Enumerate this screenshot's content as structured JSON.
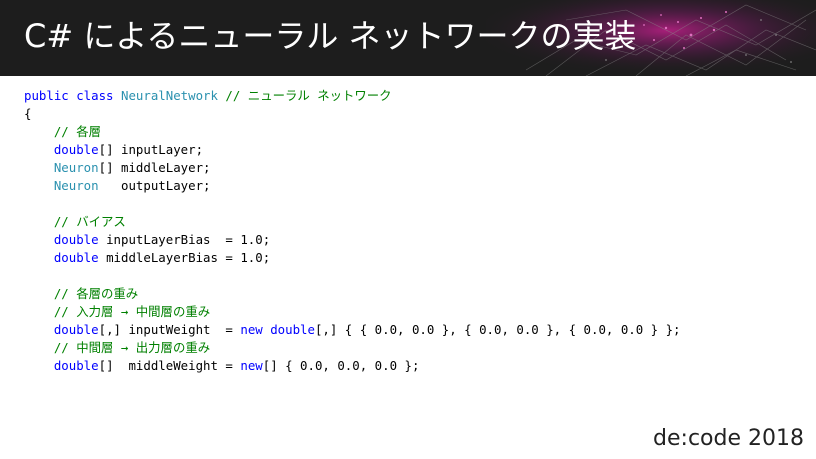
{
  "header": {
    "title": "C# によるニューラル ネットワークの実装"
  },
  "code_lines": [
    [
      {
        "t": "public ",
        "k": "k"
      },
      {
        "t": "class ",
        "k": "k"
      },
      {
        "t": "NeuralNetwork ",
        "k": "t"
      },
      {
        "t": "// ニューラル ネットワーク",
        "k": "c"
      }
    ],
    [
      {
        "t": "{",
        "k": "p"
      }
    ],
    [
      {
        "t": "    // 各層",
        "k": "c"
      }
    ],
    [
      {
        "t": "    ",
        "k": "p"
      },
      {
        "t": "double",
        "k": "k"
      },
      {
        "t": "[] inputLayer;",
        "k": "p"
      }
    ],
    [
      {
        "t": "    ",
        "k": "p"
      },
      {
        "t": "Neuron",
        "k": "t"
      },
      {
        "t": "[] middleLayer;",
        "k": "p"
      }
    ],
    [
      {
        "t": "    ",
        "k": "p"
      },
      {
        "t": "Neuron",
        "k": "t"
      },
      {
        "t": "   outputLayer;",
        "k": "p"
      }
    ],
    [],
    [
      {
        "t": "    // バイアス",
        "k": "c"
      }
    ],
    [
      {
        "t": "    ",
        "k": "p"
      },
      {
        "t": "double",
        "k": "k"
      },
      {
        "t": " inputLayerBias  = 1.0;",
        "k": "p"
      }
    ],
    [
      {
        "t": "    ",
        "k": "p"
      },
      {
        "t": "double",
        "k": "k"
      },
      {
        "t": " middleLayerBias = 1.0;",
        "k": "p"
      }
    ],
    [],
    [
      {
        "t": "    // 各層の重み",
        "k": "c"
      }
    ],
    [
      {
        "t": "    // 入力層 → 中間層の重み",
        "k": "c"
      }
    ],
    [
      {
        "t": "    ",
        "k": "p"
      },
      {
        "t": "double",
        "k": "k"
      },
      {
        "t": "[,] inputWeight  = ",
        "k": "p"
      },
      {
        "t": "new ",
        "k": "k"
      },
      {
        "t": "double",
        "k": "k"
      },
      {
        "t": "[,] { { 0.0, 0.0 }, { 0.0, 0.0 }, { 0.0, 0.0 } };",
        "k": "p"
      }
    ],
    [
      {
        "t": "    // 中間層 → 出力層の重み",
        "k": "c"
      }
    ],
    [
      {
        "t": "    ",
        "k": "p"
      },
      {
        "t": "double",
        "k": "k"
      },
      {
        "t": "[]  middleWeight = ",
        "k": "p"
      },
      {
        "t": "new",
        "k": "k"
      },
      {
        "t": "[] { 0.0, 0.0, 0.0 };",
        "k": "p"
      }
    ]
  ],
  "footer": {
    "brand": "de:code 2018"
  }
}
